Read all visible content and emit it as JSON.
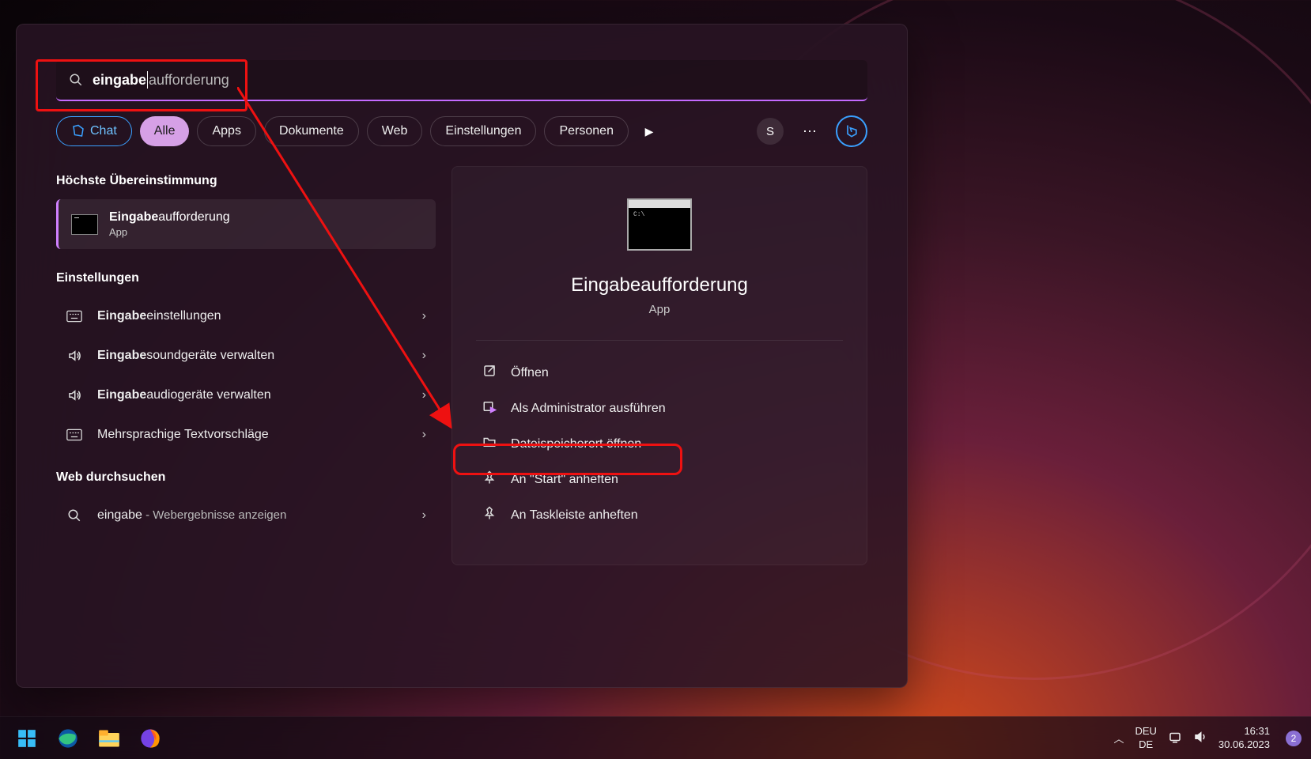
{
  "search": {
    "typed": "eingabe",
    "completion": "aufforderung"
  },
  "filters": {
    "chat": "Chat",
    "all": "Alle",
    "apps": "Apps",
    "docs": "Dokumente",
    "web": "Web",
    "settings": "Einstellungen",
    "people": "Personen",
    "avatar_letter": "S"
  },
  "left": {
    "best_match_header": "Höchste Übereinstimmung",
    "best_match": {
      "title_bold": "Eingabe",
      "title_rest": "aufforderung",
      "subtitle": "App"
    },
    "settings_header": "Einstellungen",
    "settings_items": [
      {
        "bold": "Eingabe",
        "rest": "einstellungen",
        "icon": "keyboard"
      },
      {
        "bold": "Eingabe",
        "rest": "soundgeräte verwalten",
        "icon": "sound"
      },
      {
        "bold": "Eingabe",
        "rest": "audiogeräte verwalten",
        "icon": "sound"
      },
      {
        "bold": "",
        "rest": "Mehrsprachige Textvorschläge",
        "icon": "keyboard"
      }
    ],
    "web_header": "Web durchsuchen",
    "web_item": {
      "query": "eingabe",
      "suffix": " - Webergebnisse anzeigen"
    }
  },
  "preview": {
    "title": "Eingabeaufforderung",
    "subtitle": "App",
    "actions": [
      {
        "icon": "open",
        "label": "Öffnen"
      },
      {
        "icon": "admin",
        "label": "Als Administrator ausführen"
      },
      {
        "icon": "folder",
        "label": "Dateispeicherort öffnen"
      },
      {
        "icon": "pin",
        "label": "An \"Start\" anheften"
      },
      {
        "icon": "pin",
        "label": "An Taskleiste anheften"
      }
    ]
  },
  "taskbar": {
    "lang1": "DEU",
    "lang2": "DE",
    "time": "16:31",
    "date": "30.06.2023",
    "notif_count": "2"
  }
}
